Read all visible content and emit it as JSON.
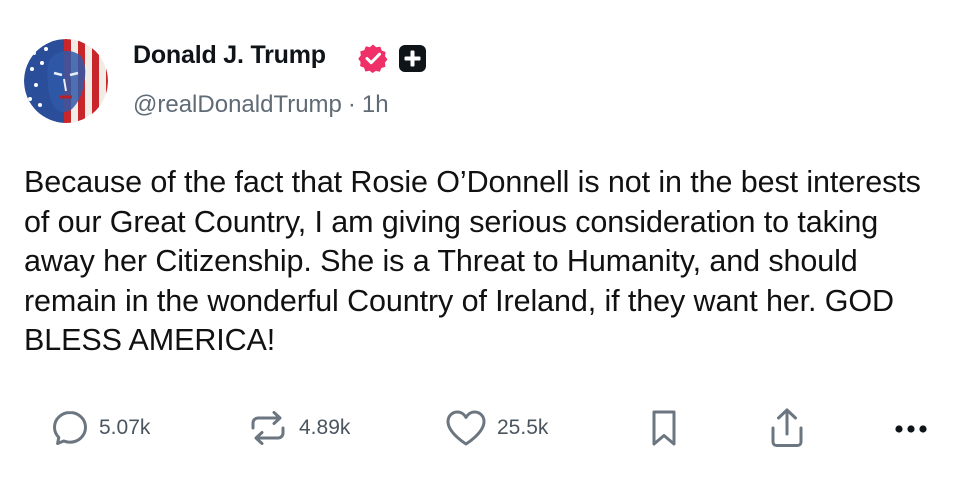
{
  "post": {
    "author": {
      "display_name": "Donald J. Trump",
      "handle": "@realDonaldTrump",
      "separator": "·",
      "timestamp": "1h",
      "avatar_icon": "avatar-portrait-flag",
      "verified_icon": "verified-badge-icon",
      "verified_color": "#ef2f68",
      "badge_icon": "plus-badge-icon"
    },
    "text": "Because of the fact that Rosie O’Donnell is not in the best interests of our Great Country, I am giving serious consideration to taking away her Citizenship. She is a Threat to Humanity, and should remain in the wonderful Country of Ireland, if they want her. GOD BLESS AMERICA!",
    "actions": {
      "replies": "5.07k",
      "reposts": "4.89k",
      "likes": "25.5k",
      "reply_icon": "reply-icon",
      "repost_icon": "repost-icon",
      "like_icon": "heart-icon",
      "bookmark_icon": "bookmark-icon",
      "share_icon": "share-icon",
      "more_icon": "more-icon"
    }
  },
  "colors": {
    "text_primary": "#0f1419",
    "text_secondary": "#606b75",
    "icon_gray": "#6b7680"
  }
}
